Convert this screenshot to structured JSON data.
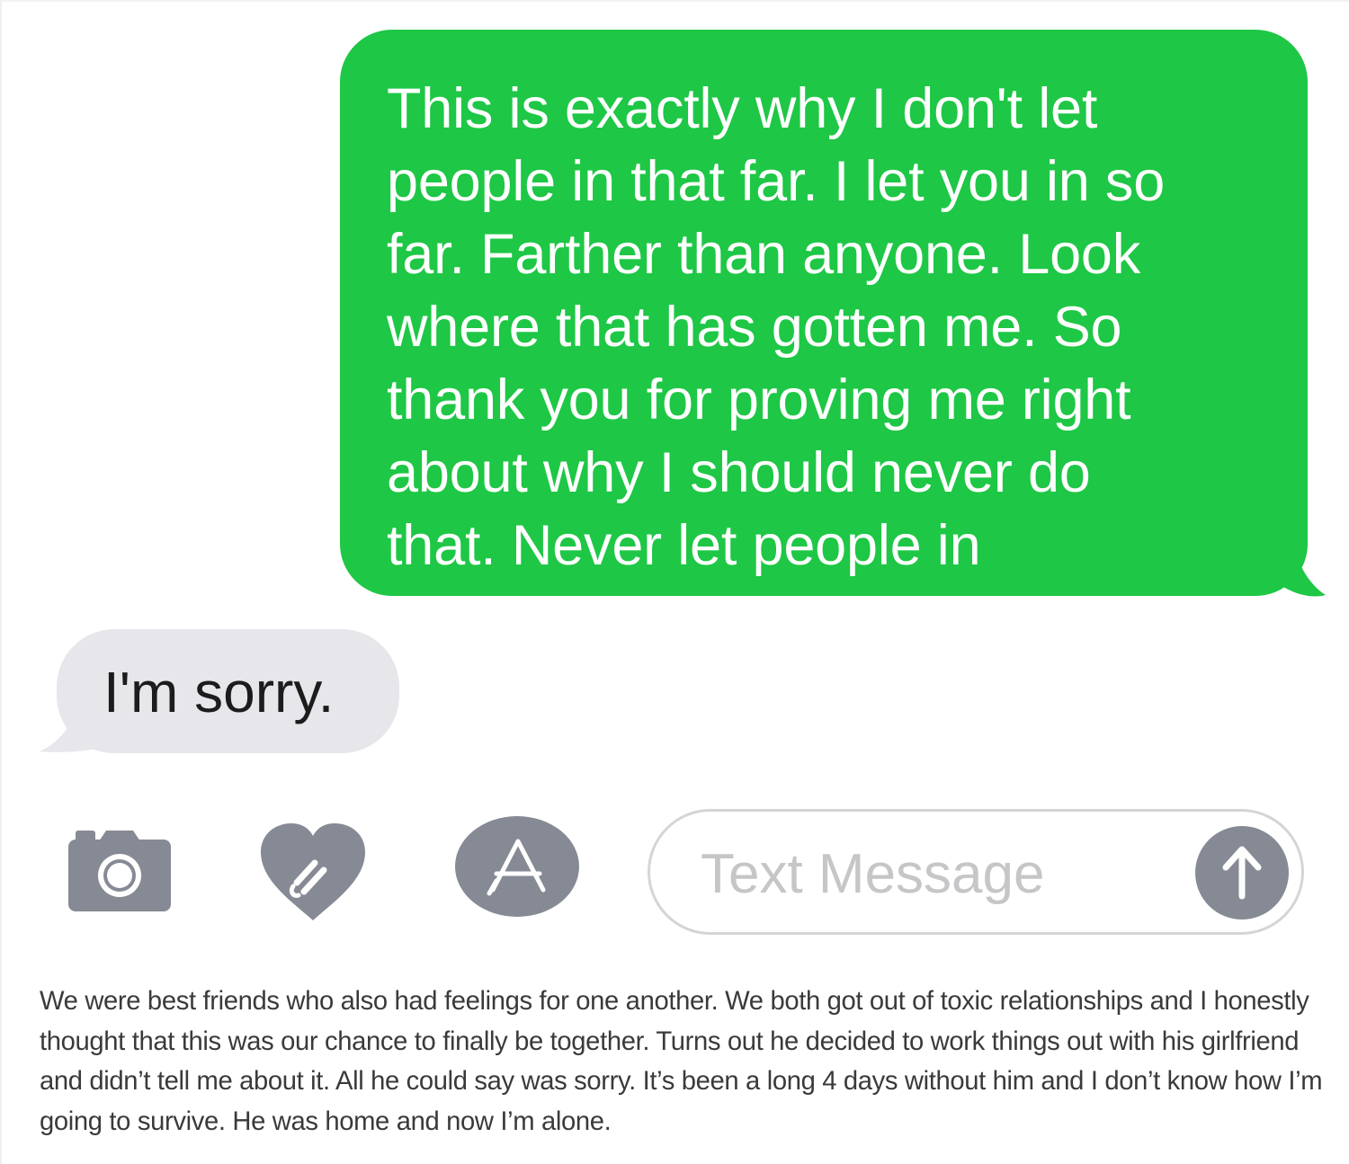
{
  "conversation": {
    "sent_message": "This is exactly why I don't let\npeople in that far. I let you in so\nfar. Farther than anyone. Look\nwhere that has gotten me. So\nthank you for proving me right\nabout why I should never do\nthat. Never let people in",
    "received_message": "I'm sorry."
  },
  "input_bar": {
    "icons": [
      "camera-icon",
      "digital-touch-heart-icon",
      "app-store-icon"
    ],
    "text_field_placeholder": "Text Message",
    "send_icon": "arrow-up-icon"
  },
  "caption": {
    "text": "We were best friends who also had feelings for one another. We both got out of toxic relationships and I honestly thought that this was our chance to finally be together. Turns out he decided to work things out with his girlfriend and didn’t tell me about it. All he could say was sorry. It’s been a long 4 days without him and I don’t know how I’m going to survive. He was home and now I’m alone."
  },
  "colors": {
    "sent_bubble": "#1ec745",
    "received_bubble": "#e6e6eb",
    "icon_gray": "#868a94",
    "placeholder_gray": "#c6c6c9"
  }
}
